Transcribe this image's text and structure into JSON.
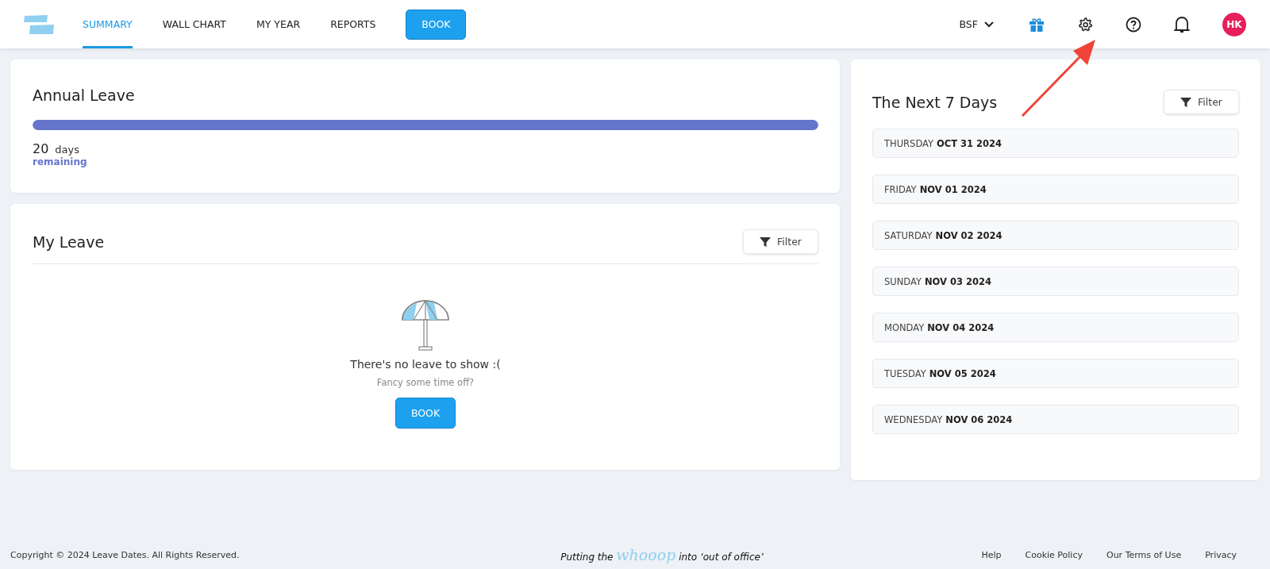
{
  "nav": {
    "tabs": [
      {
        "label": "SUMMARY",
        "selected": true
      },
      {
        "label": "WALL CHART",
        "selected": false
      },
      {
        "label": "MY YEAR",
        "selected": false
      },
      {
        "label": "REPORTS",
        "selected": false
      }
    ],
    "book_button": "BOOK",
    "org_selector": "BSF",
    "avatar_initials": "HK"
  },
  "annual_leave": {
    "title": "Annual Leave",
    "level": 1,
    "count": "20",
    "unit": "days",
    "caption": "remaining"
  },
  "my_leave": {
    "title": "My Leave",
    "filter_button": "Filter",
    "empty_title": "There's no leave to show :(",
    "empty_subtitle": "Fancy some time off?",
    "book_button": "BOOK"
  },
  "next_days": {
    "title": "The Next 7 Days",
    "filter_button": "Filter",
    "days": [
      {
        "weekday": "THURSDAY",
        "date": "OCT 31 2024"
      },
      {
        "weekday": "FRIDAY",
        "date": "NOV 01 2024"
      },
      {
        "weekday": "SATURDAY",
        "date": "NOV 02 2024"
      },
      {
        "weekday": "SUNDAY",
        "date": "NOV 03 2024"
      },
      {
        "weekday": "MONDAY",
        "date": "NOV 04 2024"
      },
      {
        "weekday": "TUESDAY",
        "date": "NOV 05 2024"
      },
      {
        "weekday": "WEDNESDAY",
        "date": "NOV 06 2024"
      }
    ]
  },
  "footer": {
    "copyright": "Copyright © 2024 Leave Dates. All Rights Reserved.",
    "tagline_before": "Putting the",
    "tagline_word": "whooop",
    "tagline_after": "into ‘out of office’",
    "links": [
      "Help",
      "Cookie Policy",
      "Our Terms of Use",
      "Privacy"
    ]
  }
}
